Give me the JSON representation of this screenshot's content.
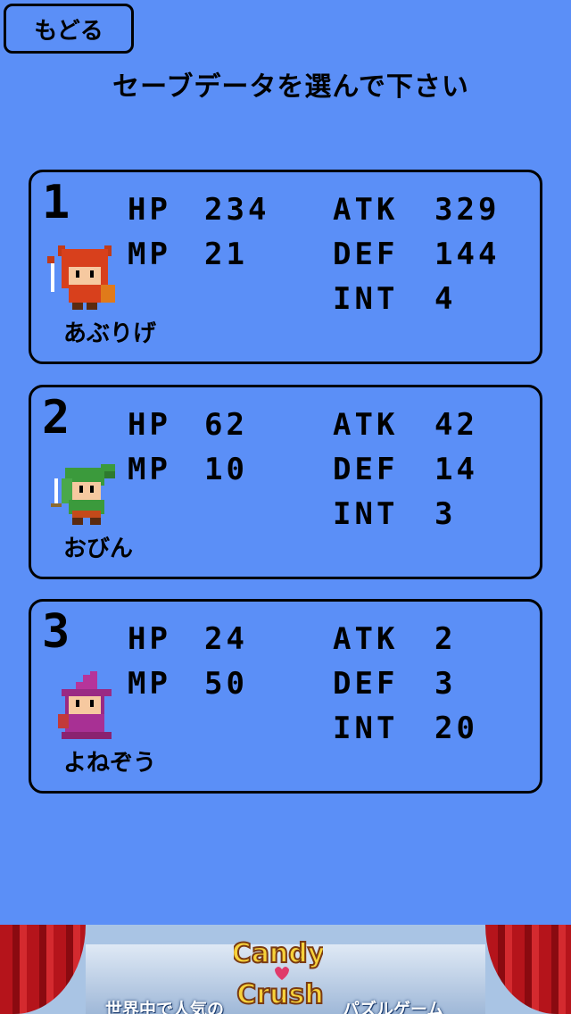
{
  "header": {
    "back_label": "もどる",
    "title": "セーブデータを選んで下さい"
  },
  "slots": [
    {
      "number": "1",
      "name": "あぶりげ",
      "hp_label": "HP",
      "hp": "234",
      "mp_label": "MP",
      "mp": "21",
      "atk_label": "ATK",
      "atk": "329",
      "def_label": "DEF",
      "def": "144",
      "int_label": "INT",
      "int": "4",
      "avatar": "red-horned-warrior-sprite"
    },
    {
      "number": "2",
      "name": "おびん",
      "hp_label": "HP",
      "hp": "62",
      "mp_label": "MP",
      "mp": "10",
      "atk_label": "ATK",
      "atk": "42",
      "def_label": "DEF",
      "def": "14",
      "int_label": "INT",
      "int": "3",
      "avatar": "green-bandana-swordsman-sprite"
    },
    {
      "number": "3",
      "name": "よねぞう",
      "hp_label": "HP",
      "hp": "24",
      "mp_label": "MP",
      "mp": "50",
      "atk_label": "ATK",
      "atk": "2",
      "def_label": "DEF",
      "def": "3",
      "int_label": "INT",
      "int": "20",
      "avatar": "purple-witch-sprite"
    }
  ],
  "ad": {
    "left_text": "世界中で人気の",
    "right_text": "パズルゲーム",
    "logo_top": "Candy",
    "logo_bottom": "Crush"
  },
  "colors": {
    "background": "#5b8ff7",
    "border": "#000000"
  }
}
